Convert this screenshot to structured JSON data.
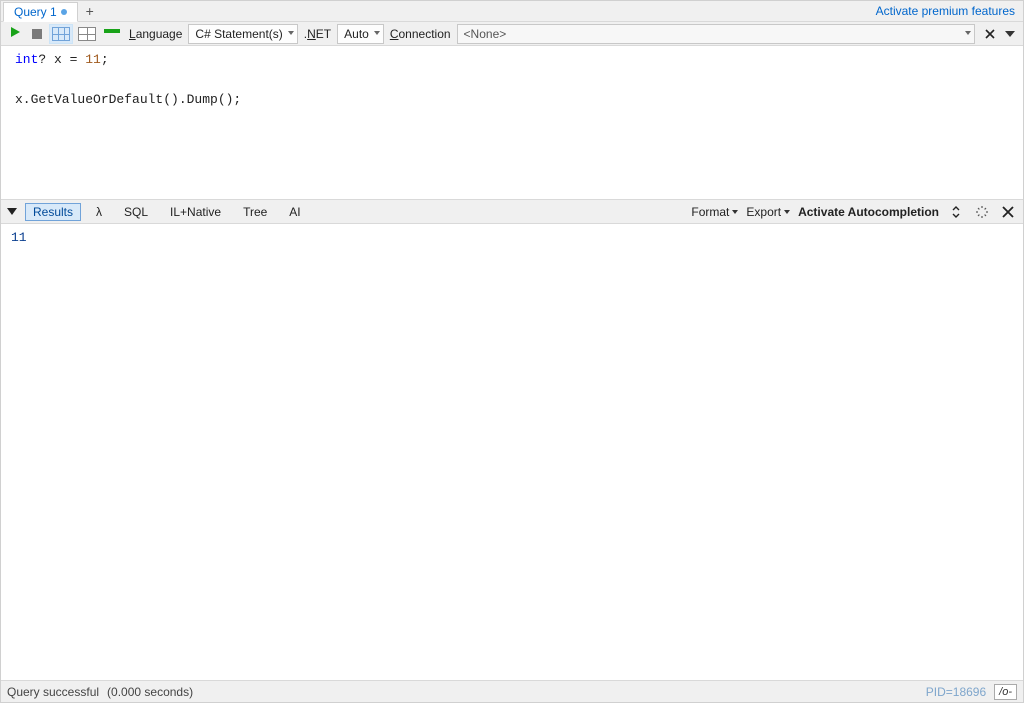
{
  "tabs": {
    "items": [
      {
        "label": "Query 1",
        "dirty": true
      }
    ]
  },
  "header": {
    "premium_link": "Activate premium features"
  },
  "toolbar": {
    "language_label": "Language",
    "language_value": "C# Statement(s)",
    "dotnet_label": ".NET",
    "dotnet_value": "Auto",
    "connection_label": "Connection",
    "connection_value": "<None>"
  },
  "editor": {
    "lines": [
      {
        "type": "code1"
      },
      {
        "type": "blank"
      },
      {
        "type": "code2"
      }
    ],
    "tokens": {
      "int": "int",
      "qmark": "?",
      "var": " x ",
      "eq": "= ",
      "lit": "11",
      "semi": ";",
      "line2": "x.GetValueOrDefault().Dump();"
    }
  },
  "results_tabs": {
    "items": [
      {
        "label": "Results",
        "active": true
      },
      {
        "label": "λ"
      },
      {
        "label": "SQL"
      },
      {
        "label": "IL+Native"
      },
      {
        "label": "Tree"
      },
      {
        "label": "AI"
      }
    ],
    "format_label": "Format",
    "export_label": "Export",
    "autocomplete_label": "Activate Autocompletion"
  },
  "results": {
    "output": "11"
  },
  "status": {
    "message": "Query successful",
    "timing": "(0.000 seconds)",
    "pid": "PID=18696",
    "outline": "/o-"
  }
}
